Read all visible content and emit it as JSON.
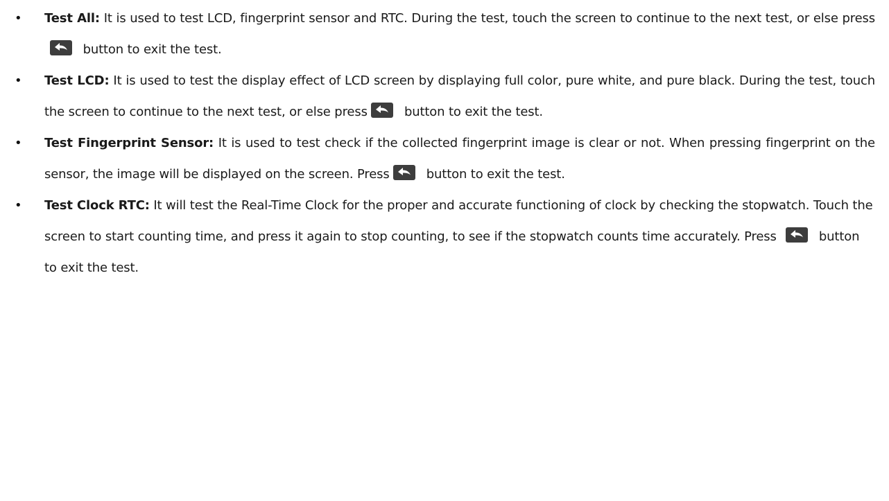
{
  "bullet_char": "•",
  "icons": {
    "back_button": "back-arrow-icon"
  },
  "items": [
    {
      "term": "Test All:",
      "text_before": " It is used to test LCD, fingerprint sensor and RTC. During the test, touch the screen to continue to the next test, or else press ",
      "text_after": " button to exit the test."
    },
    {
      "term": "Test LCD:",
      "text_before": " It is used to test the display effect of LCD screen by displaying full color, pure white, and pure black. During the test, touch the screen to continue to the next test, or else press ",
      "text_after": " button to exit the test."
    },
    {
      "term": "Test Fingerprint Sensor:",
      "text_before": " It is used to test check if the collected fingerprint image is clear or not. When pressing fingerprint on the sensor, the image will be displayed on the screen. Press ",
      "text_after": " button to exit the test."
    },
    {
      "term": "Test Clock RTC:",
      "text_before": " It will test the Real-Time Clock for the proper and accurate functioning of clock by checking the stopwatch. Touch the screen to start counting time, and press it again to stop counting, to see if the stopwatch counts time accurately. Press ",
      "text_after": " button to exit the test."
    }
  ]
}
